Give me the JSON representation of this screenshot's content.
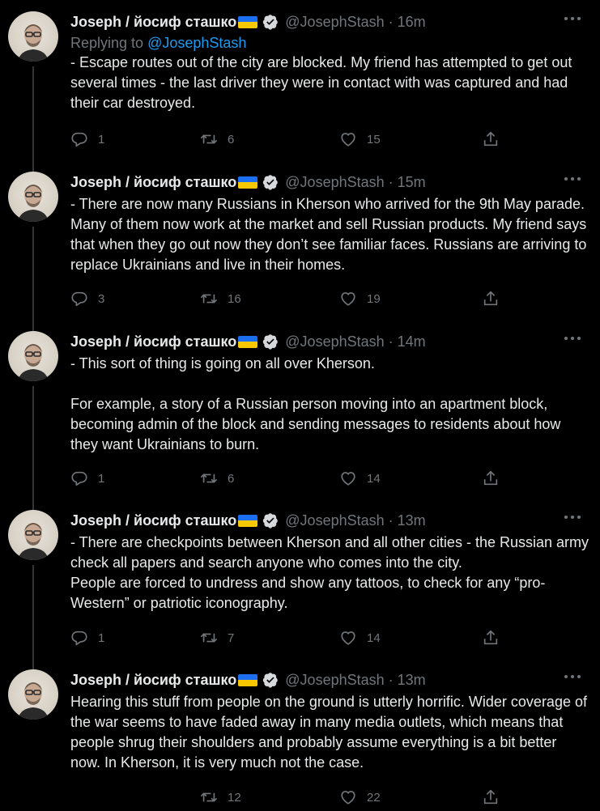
{
  "author": {
    "name": "Joseph / йосиф сташко",
    "handle": "@JosephStash"
  },
  "replying": {
    "prefix": "Replying to ",
    "handle": "@JosephStash"
  },
  "tweets": [
    {
      "time": "16m",
      "text": "- Escape routes out of the city are blocked. My friend has attempted to get out several times - the last driver they were in contact with was captured and had their car destroyed.",
      "replies": "1",
      "retweets": "6",
      "likes": "15"
    },
    {
      "time": "15m",
      "text": "- There are now many Russians in Kherson who arrived for the 9th May parade. Many of them now work at the market and sell Russian products. My friend says that when they go out now they don’t see familiar faces. Russians are arriving to replace Ukrainians and live in their homes.",
      "replies": "3",
      "retweets": "16",
      "likes": "19"
    },
    {
      "time": "14m",
      "text": "- This sort of thing is going on all over Kherson.\n\nFor example, a story of a Russian person moving into an apartment block, becoming admin of the block and sending messages to residents about how they want Ukrainians to burn.",
      "replies": "1",
      "retweets": "6",
      "likes": "14"
    },
    {
      "time": "13m",
      "text": "- There are checkpoints between Kherson and all other cities - the Russian army check all papers and search anyone who comes into the city.\nPeople are forced to undress and show any tattoos, to check for any “pro-Western” or patriotic iconography.",
      "replies": "1",
      "retweets": "7",
      "likes": "14"
    },
    {
      "time": "13m",
      "text": "Hearing this stuff from people on the ground is utterly horrific. Wider coverage of the war seems to have faded away in many media outlets, which means that people shrug their shoulders and probably assume everything is a bit better now. In Kherson, it is very much not the case.",
      "replies": "",
      "retweets": "12",
      "likes": "22"
    }
  ],
  "separator": "·",
  "icons": {
    "reply": "reply-icon",
    "retweet": "retweet-icon",
    "like": "heart-icon",
    "share": "share-icon",
    "verified": "verified-badge-icon",
    "more": "more-icon",
    "flag": "ukraine-flag-icon"
  },
  "colors": {
    "background": "#000000",
    "text": "#e7e9ea",
    "muted": "#71767b",
    "link": "#1d9bf0",
    "thread_line": "#333639",
    "flag_blue": "#1d6ff2",
    "flag_yellow": "#f7c700"
  }
}
